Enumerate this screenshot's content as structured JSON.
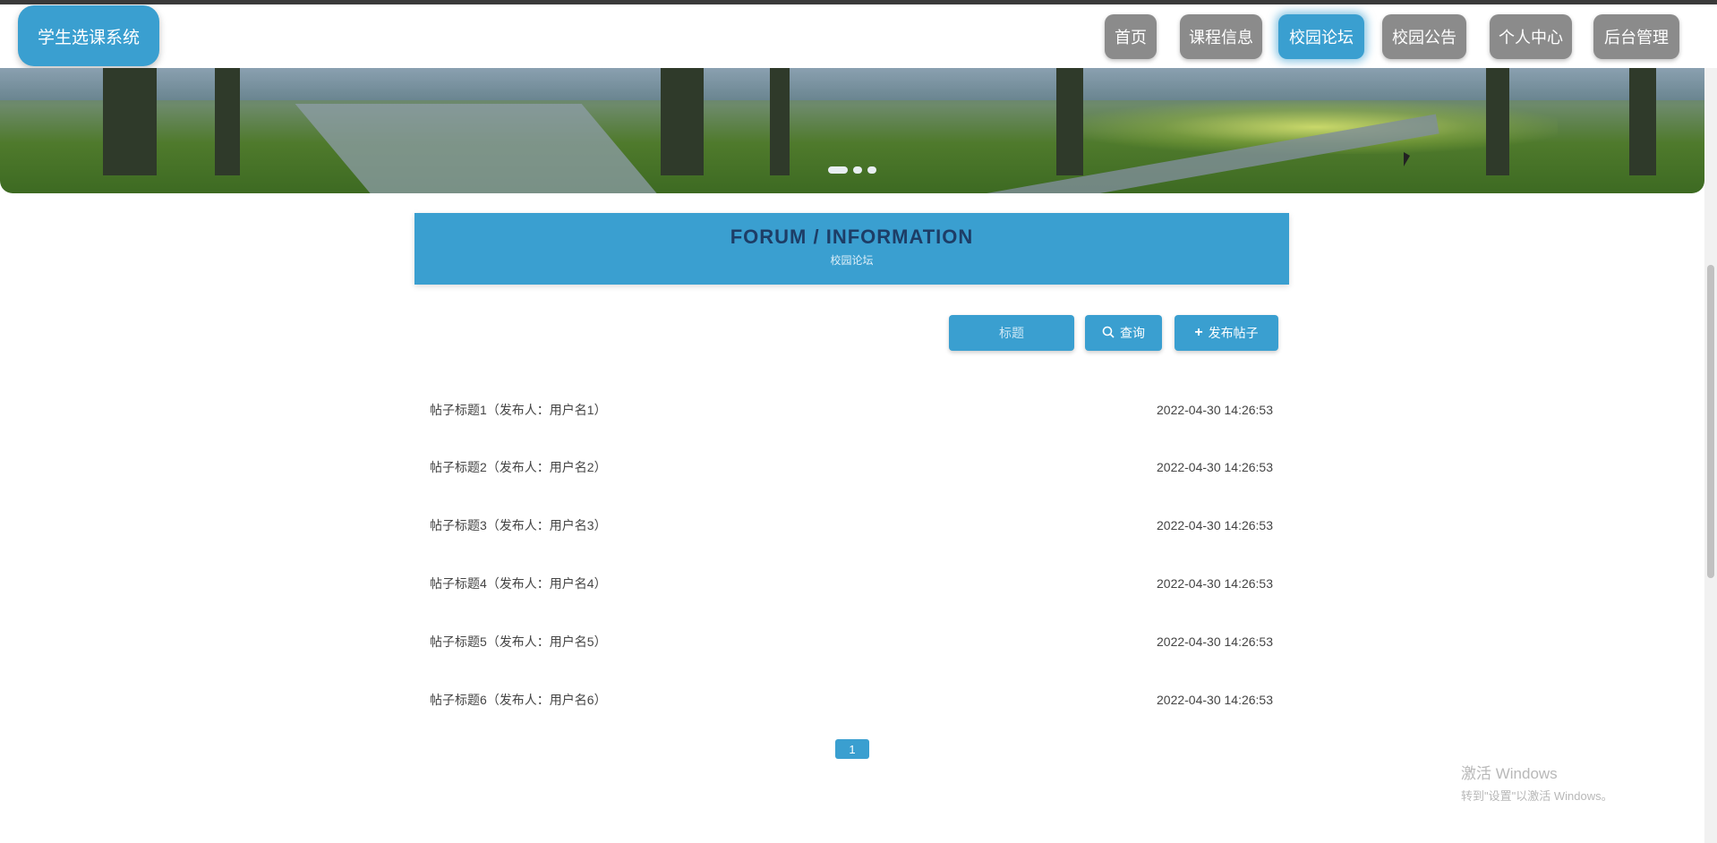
{
  "app": {
    "title": "学生选课系统"
  },
  "nav": {
    "items": [
      {
        "label": "首页",
        "active": false
      },
      {
        "label": "课程信息",
        "active": false
      },
      {
        "label": "校园论坛",
        "active": true
      },
      {
        "label": "校园公告",
        "active": false
      },
      {
        "label": "个人中心",
        "active": false
      },
      {
        "label": "后台管理",
        "active": false
      }
    ]
  },
  "page": {
    "heading": "FORUM / INFORMATION",
    "subheading": "校园论坛"
  },
  "toolbar": {
    "search_placeholder": "标题",
    "search_button": "查询",
    "add_button": "发布帖子",
    "search_icon": "search-icon",
    "add_icon": "plus-icon"
  },
  "posts": [
    {
      "title": "帖子标题1（发布人：用户名1）",
      "time": "2022-04-30 14:26:53"
    },
    {
      "title": "帖子标题2（发布人：用户名2）",
      "time": "2022-04-30 14:26:53"
    },
    {
      "title": "帖子标题3（发布人：用户名3）",
      "time": "2022-04-30 14:26:53"
    },
    {
      "title": "帖子标题4（发布人：用户名4）",
      "time": "2022-04-30 14:26:53"
    },
    {
      "title": "帖子标题5（发布人：用户名5）",
      "time": "2022-04-30 14:26:53"
    },
    {
      "title": "帖子标题6（发布人：用户名6）",
      "time": "2022-04-30 14:26:53"
    }
  ],
  "pager": {
    "current": "1"
  },
  "watermark": {
    "line1": "激活 Windows",
    "line2": "转到\"设置\"以激活 Windows。"
  },
  "colors": {
    "accent": "#3a9fd0",
    "nav_inactive": "#8b8b8b",
    "heading_text": "#1d3d66"
  }
}
